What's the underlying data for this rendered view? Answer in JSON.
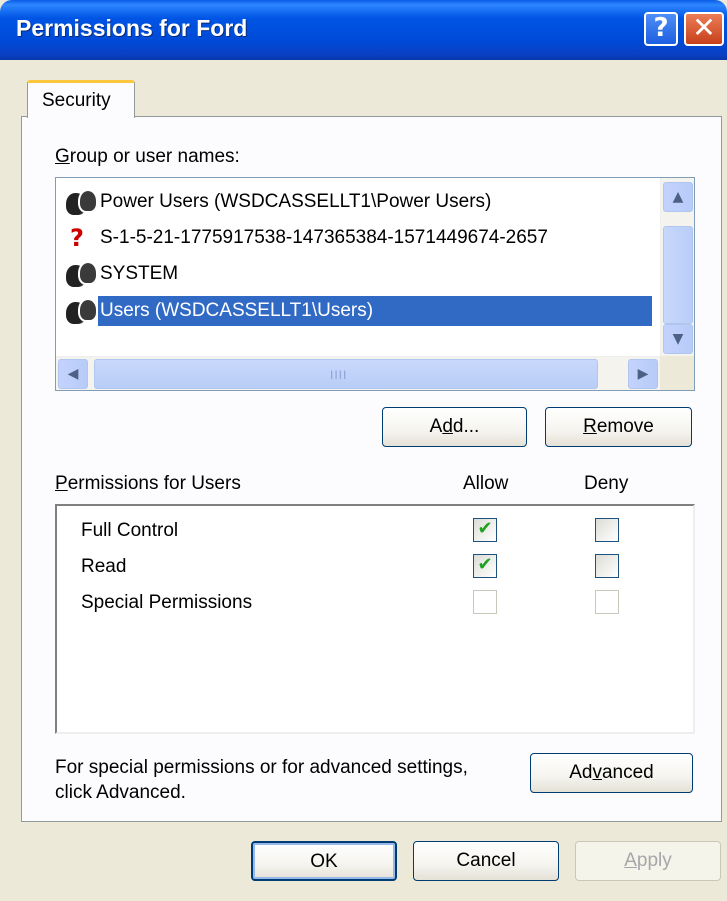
{
  "window": {
    "title": "Permissions for Ford",
    "help_glyph": "?",
    "close_glyph": "✕"
  },
  "tabs": [
    {
      "label": "Security"
    }
  ],
  "group_list": {
    "label_accel": "G",
    "label_rest": "roup or user names:",
    "items": [
      {
        "name": "Power Users (WSDCASSELLT1\\Power Users)",
        "icon": "group-icon",
        "selected": false
      },
      {
        "name": "S-1-5-21-1775917538-147365384-1571449674-2657",
        "icon": "unknown-account-icon",
        "selected": false
      },
      {
        "name": "SYSTEM",
        "icon": "group-icon",
        "selected": false
      },
      {
        "name": "Users (WSDCASSELLT1\\Users)",
        "icon": "group-icon",
        "selected": true
      }
    ],
    "scroll_up": "▲",
    "scroll_down": "▼",
    "scroll_left": "◀",
    "scroll_right": "▶",
    "grip": "IIII"
  },
  "buttons": {
    "add_pre": "A",
    "add_accel": "d",
    "add_post": "d...",
    "remove_accel": "R",
    "remove_rest": "emove",
    "advanced_pre": "Ad",
    "advanced_accel": "v",
    "advanced_post": "anced",
    "ok": "OK",
    "cancel": "Cancel",
    "apply_accel": "A",
    "apply_rest": "pply"
  },
  "permissions": {
    "header_accel": "P",
    "header_rest": "ermissions for Users",
    "allow_header": "Allow",
    "deny_header": "Deny",
    "rows": [
      {
        "name": "Full Control",
        "allow": true,
        "deny": false,
        "enabled": true
      },
      {
        "name": "Read",
        "allow": true,
        "deny": false,
        "enabled": true
      },
      {
        "name": "Special Permissions",
        "allow": false,
        "deny": false,
        "enabled": false
      }
    ],
    "check_glyph": "✔"
  },
  "advanced_note": {
    "line1": "For special permissions or for advanced settings,",
    "line2": "click Advanced."
  }
}
